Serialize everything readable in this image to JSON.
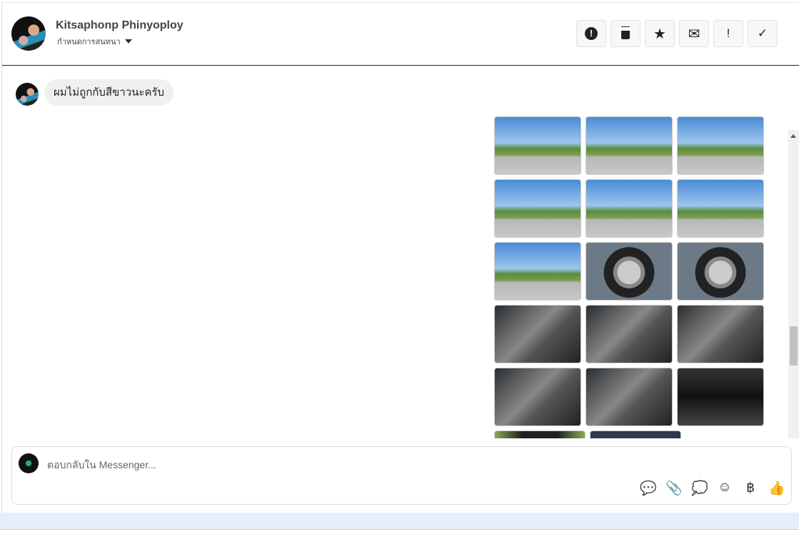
{
  "header": {
    "name": "Kitsaphonp Phinyoploy",
    "subtitle": "กำหนดการสนทนา",
    "tools": [
      {
        "icon": "alert-circle-icon",
        "glyph": "⬤"
      },
      {
        "icon": "trash-icon",
        "glyph": "🗑"
      },
      {
        "icon": "star-icon",
        "glyph": "★"
      },
      {
        "icon": "mail-open-icon",
        "glyph": "✉"
      },
      {
        "icon": "exclamation-icon",
        "glyph": "!"
      },
      {
        "icon": "check-icon",
        "glyph": "✓"
      }
    ]
  },
  "messages": [
    {
      "text": "ผมไม่ถูกกับสีขาวนะครับ"
    }
  ],
  "composer": {
    "placeholder": "ตอบกลับใน Messenger...",
    "icons": [
      {
        "icon": "saved-reply-icon",
        "glyph": "💬"
      },
      {
        "icon": "attachment-icon",
        "glyph": "📎"
      },
      {
        "icon": "chat-dots-icon",
        "glyph": "💭"
      },
      {
        "icon": "emoji-icon",
        "glyph": "☺"
      },
      {
        "icon": "baht-icon",
        "glyph": "฿"
      },
      {
        "icon": "thumbs-up-icon",
        "glyph": "👍"
      }
    ]
  }
}
